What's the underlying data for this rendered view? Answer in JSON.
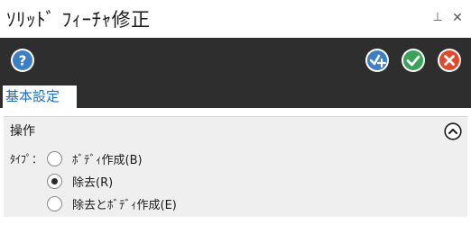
{
  "window": {
    "title": "ｿﾘｯﾄﾞ ﾌｨｰﾁｬ修正",
    "pin_glyph": "⊥",
    "close_glyph": "✕"
  },
  "toolbar": {
    "help_icon": "help-icon",
    "apply_continue_icon": "check-plus-icon",
    "ok_icon": "check-icon",
    "cancel_icon": "cancel-icon",
    "colors": {
      "blue": "#3d7fc4",
      "green": "#3aa35a",
      "red": "#e0492b",
      "background": "#2e2e2e"
    }
  },
  "tabs": [
    {
      "label": "基本設定",
      "active": true
    }
  ],
  "operation": {
    "title": "操作",
    "type_label": "ﾀｲﾌﾟ：",
    "options": [
      {
        "label": "ﾎﾞﾃﾞｨ作成(B)",
        "selected": false
      },
      {
        "label": "除去(R)",
        "selected": true
      },
      {
        "label": "除去とﾎﾞﾃﾞｨ作成(E)",
        "selected": false
      }
    ]
  }
}
